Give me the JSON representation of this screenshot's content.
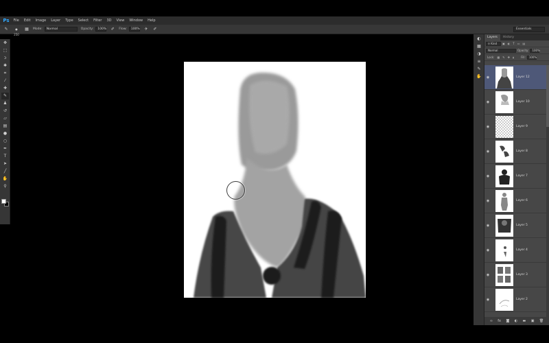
{
  "app": {
    "logo": "Ps"
  },
  "menu": [
    "File",
    "Edit",
    "Image",
    "Layer",
    "Type",
    "Select",
    "Filter",
    "3D",
    "View",
    "Window",
    "Help"
  ],
  "options": {
    "brush_size": "250",
    "mode_label": "Mode:",
    "mode_value": "Normal",
    "opacity_label": "Opacity:",
    "opacity_value": "100%",
    "flow_label": "Flow:",
    "flow_value": "100%",
    "workspace": "Essentials"
  },
  "panel": {
    "tabs": [
      "Layers",
      "History"
    ],
    "kind": "Kind",
    "blend_mode": "Normal",
    "opacity_label": "Opacity:",
    "opacity_value": "100%",
    "lock_label": "Lock:",
    "fill_label": "Fill:",
    "fill_value": "100%"
  },
  "layers": [
    {
      "name": "Layer 12",
      "selected": true
    },
    {
      "name": "Layer 10",
      "selected": false
    },
    {
      "name": "Layer 9",
      "selected": false
    },
    {
      "name": "Layer 8",
      "selected": false
    },
    {
      "name": "Layer 7",
      "selected": false
    },
    {
      "name": "Layer 6",
      "selected": false
    },
    {
      "name": "Layer 5",
      "selected": false
    },
    {
      "name": "Layer 4",
      "selected": false
    },
    {
      "name": "Layer 3",
      "selected": false
    },
    {
      "name": "Layer 2",
      "selected": false
    }
  ],
  "colors": {
    "foreground": "#ffffff",
    "background": "#000000",
    "selected_layer": "#4e5878"
  }
}
